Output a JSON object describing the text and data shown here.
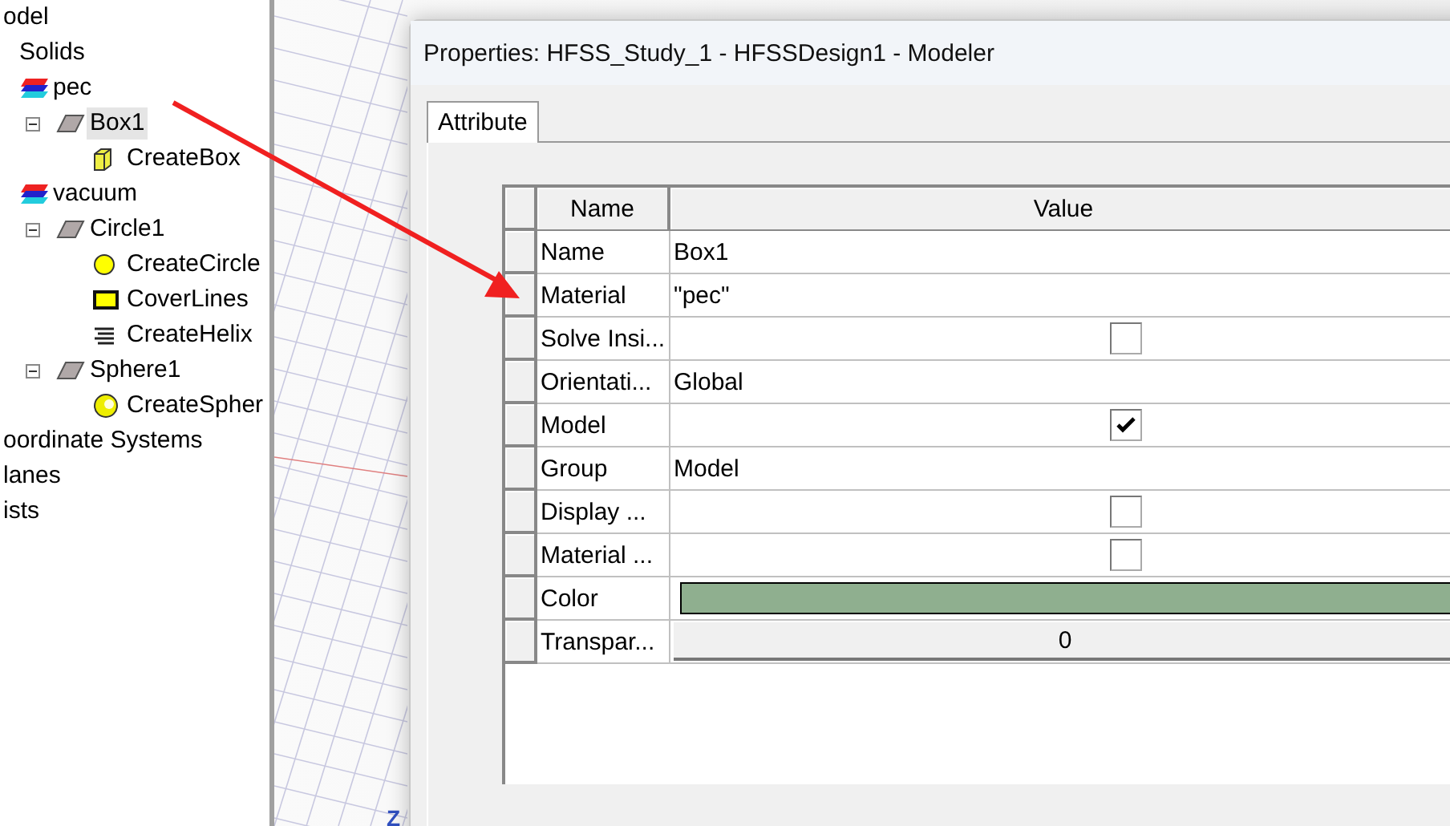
{
  "tree": [
    {
      "label": "odel",
      "selected": false,
      "children": [
        {
          "label": "Solids",
          "selected": false,
          "children": [
            {
              "label": "pec",
              "kind": "material",
              "selected": false,
              "children": [
                {
                  "label": "Box1",
                  "kind": "object",
                  "expanded": true,
                  "selected": true,
                  "children": [
                    {
                      "label": "CreateBox",
                      "kind": "box",
                      "selected": false
                    }
                  ]
                }
              ]
            },
            {
              "label": "vacuum",
              "kind": "material",
              "selected": false,
              "children": [
                {
                  "label": "Circle1",
                  "kind": "object",
                  "expanded": true,
                  "selected": false,
                  "children": [
                    {
                      "label": "CreateCircle",
                      "kind": "circle",
                      "selected": false
                    },
                    {
                      "label": "CoverLines",
                      "kind": "cover",
                      "selected": false
                    },
                    {
                      "label": "CreateHelix",
                      "kind": "helix",
                      "selected": false
                    }
                  ]
                },
                {
                  "label": "Sphere1",
                  "kind": "object",
                  "expanded": true,
                  "selected": false,
                  "children": [
                    {
                      "label": "CreateSpher",
                      "kind": "sphere",
                      "selected": false
                    }
                  ]
                }
              ]
            }
          ]
        }
      ]
    },
    {
      "label": "oordinate Systems",
      "selected": false
    },
    {
      "label": "lanes",
      "selected": false
    },
    {
      "label": "ists",
      "selected": false
    }
  ],
  "viewport": {
    "axis_label": "Z"
  },
  "dialog": {
    "title": "Properties: HFSS_Study_1 - HFSSDesign1 - Modeler",
    "tabs": [
      {
        "label": "Attribute",
        "selected": true
      }
    ],
    "table": {
      "columns": [
        "Name",
        "Value"
      ],
      "rows": [
        {
          "name": "Name",
          "kind": "text",
          "value": "Box1"
        },
        {
          "name": "Material",
          "kind": "text",
          "value": "\"pec\""
        },
        {
          "name": "Solve Insi...",
          "kind": "checkbox",
          "checked": false
        },
        {
          "name": "Orientati...",
          "kind": "text",
          "value": "Global"
        },
        {
          "name": "Model",
          "kind": "checkbox",
          "checked": true
        },
        {
          "name": "Group",
          "kind": "text",
          "value": "Model"
        },
        {
          "name": "Display ...",
          "kind": "checkbox",
          "checked": false
        },
        {
          "name": "Material ...",
          "kind": "checkbox",
          "checked": false
        },
        {
          "name": "Color",
          "kind": "color",
          "color": "#8faf8f"
        },
        {
          "name": "Transpar...",
          "kind": "number",
          "value": "0"
        }
      ]
    }
  }
}
